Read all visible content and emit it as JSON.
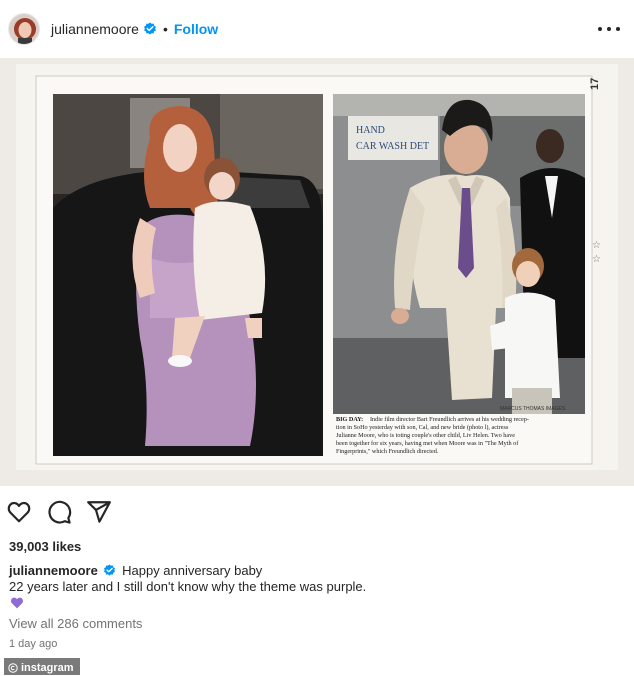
{
  "header": {
    "username": "juliannemoore",
    "separator": "•",
    "follow_label": "Follow",
    "verified_icon": "verified-badge-icon",
    "more_icon": "more-options-icon"
  },
  "post_image": {
    "description_icon": "newspaper-clipping-photo",
    "page_number": "17",
    "photo_credit": "MARCUS THOMAS IMAGES",
    "sign_text_1": "HAND",
    "sign_text_2": "CAR WASH DET",
    "clipping_caption": {
      "lead": "BIG DAY:",
      "lines": [
        "Indie film director Bart Freundlich arrives at his wedding recep-",
        "tion in SoHo yesterday with son, Cal, and new bride (photo l), actress",
        "Julianne Moore, who is toting couple's other child, Liv Helen. Two have",
        "been together for six years, having met when Moore was in \"The Myth of",
        "Fingerprints,\" which Freundlich directed."
      ]
    }
  },
  "actions": {
    "like_icon": "heart-icon",
    "comment_icon": "comment-icon",
    "share_icon": "share-icon"
  },
  "likes_text": "39,003 likes",
  "caption": {
    "username": "juliannemoore",
    "line1": "Happy anniversary baby",
    "line2": "22 years later and I still don't know why the theme was purple."
  },
  "view_comments": "View all 286 comments",
  "timestamp": "1 day ago",
  "watermark": "instagram",
  "colors": {
    "follow": "#0095f6",
    "verified": "#0095f6",
    "purple_heart": "#8e6cd6",
    "text": "#262626",
    "secondary_text": "#737373"
  }
}
